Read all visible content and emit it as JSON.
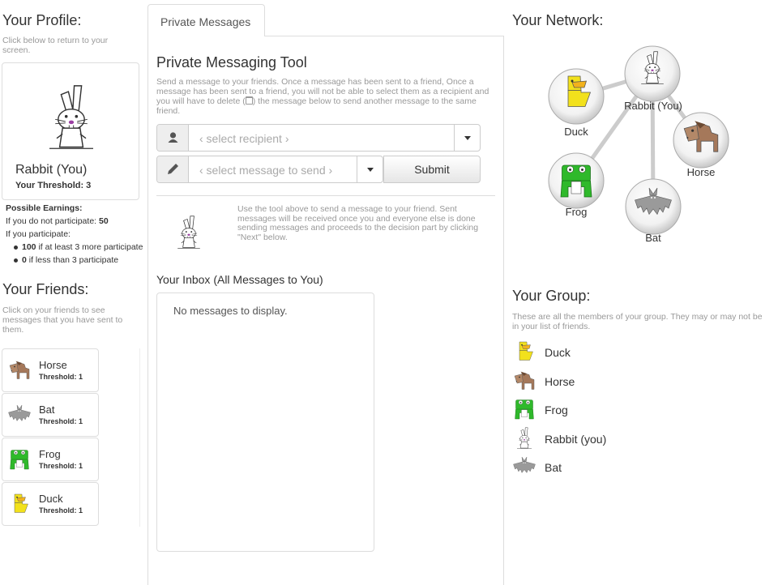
{
  "profile": {
    "title": "Your Profile:",
    "hint": "Click below to return to your screen.",
    "name": "Rabbit (You)",
    "threshold": "Your Threshold: 3"
  },
  "earnings": {
    "heading": "Possible Earnings:",
    "no_participate": "If you do not participate:",
    "no_participate_value": "50",
    "participate": "If you participate:",
    "options": [
      {
        "value": "100",
        "text": "if at least 3 more participate"
      },
      {
        "value": "0",
        "text": "if less than 3 participate"
      }
    ]
  },
  "friends": {
    "title": "Your Friends:",
    "hint": "Click on your friends to see messages that you have sent to them.",
    "items": [
      {
        "name": "Horse",
        "threshold": "Threshold: 1",
        "icon": "horse-icon"
      },
      {
        "name": "Bat",
        "threshold": "Threshold: 1",
        "icon": "bat-icon"
      },
      {
        "name": "Frog",
        "threshold": "Threshold: 1",
        "icon": "frog-icon"
      },
      {
        "name": "Duck",
        "threshold": "Threshold: 1",
        "icon": "duck-icon"
      }
    ]
  },
  "tabs": [
    {
      "label": "Private Messages",
      "active": true
    }
  ],
  "tool": {
    "title": "Private Messaging Tool",
    "desc_before": "Send a message to your friends. Once a message has been sent to a friend, Once a message has been sent to a friend, you will not be able to select them as a recipient and you will have to delete (",
    "desc_after": ") the message below to send another message to the same friend.",
    "recipient_placeholder": "‹ select recipient ›",
    "message_placeholder": "‹ select message to send ›",
    "submit_label": "Submit",
    "help": "Use the tool above to send a message to your friend. Sent messages will be received once you and everyone else is done sending messages and proceeds to the decision part by clicking \"Next\" below."
  },
  "inbox": {
    "title": "Your Inbox (All Messages to You)",
    "empty": "No messages to display."
  },
  "network": {
    "title": "Your Network:",
    "nodes": [
      {
        "label": "Duck",
        "icon": "duck-icon"
      },
      {
        "label": "Rabbit (You)",
        "icon": "rabbit-icon"
      },
      {
        "label": "Horse",
        "icon": "horse-icon"
      },
      {
        "label": "Frog",
        "icon": "frog-icon"
      },
      {
        "label": "Bat",
        "icon": "bat-icon"
      }
    ]
  },
  "group": {
    "title": "Your Group:",
    "hint": "These are all the members of your group. They may or may not be in your list of friends.",
    "members": [
      {
        "name": "Duck",
        "icon": "duck-icon"
      },
      {
        "name": "Horse",
        "icon": "horse-icon"
      },
      {
        "name": "Frog",
        "icon": "frog-icon"
      },
      {
        "name": "Rabbit (you)",
        "icon": "rabbit-icon"
      },
      {
        "name": "Bat",
        "icon": "bat-icon"
      }
    ]
  },
  "colors": {
    "duck": "#f2e11c",
    "duck_beak": "#f2b21c",
    "horse": "#a5785a",
    "frog": "#2fb92b",
    "bat": "#9a9a9a",
    "rabbit_nose": "#9b3fa3"
  }
}
